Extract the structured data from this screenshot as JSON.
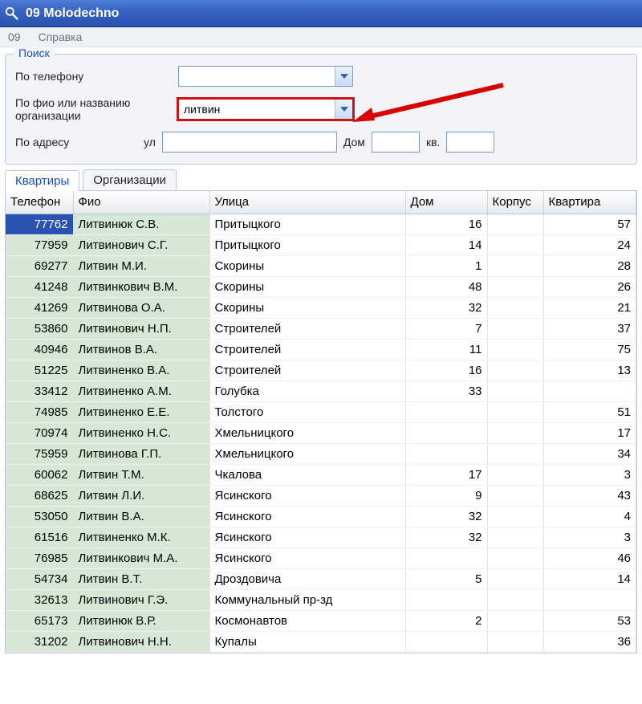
{
  "title": "09 Molodechno",
  "menu": {
    "item1": "09",
    "item2": "Справка"
  },
  "search": {
    "legend": "Поиск",
    "by_phone_label": "По телефону",
    "by_phone_value": "",
    "by_name_label": "По фио или названию организации",
    "by_name_value": "литвин",
    "by_addr_label": "По адресу",
    "street_label": "ул",
    "street_value": "",
    "house_label": "Дом",
    "house_value": "",
    "flat_label": "кв.",
    "flat_value": ""
  },
  "tabs": {
    "tab1": "Квартиры",
    "tab2": "Организации"
  },
  "columns": {
    "tel": "Телефон",
    "fio": "Фио",
    "street": "Улица",
    "house": "Дом",
    "korpus": "Корпус",
    "flat": "Квартира"
  },
  "rows": [
    {
      "tel": "77762",
      "fio": "Литвинюк С.В.",
      "street": "Притыцкого",
      "house": "16",
      "korpus": "",
      "flat": "57",
      "selected": true
    },
    {
      "tel": "77959",
      "fio": "Литвинович С.Г.",
      "street": "Притыцкого",
      "house": "14",
      "korpus": "",
      "flat": "24"
    },
    {
      "tel": "69277",
      "fio": "Литвин М.И.",
      "street": "Скорины",
      "house": "1",
      "korpus": "",
      "flat": "28"
    },
    {
      "tel": "41248",
      "fio": "Литвинкович В.М.",
      "street": "Скорины",
      "house": "48",
      "korpus": "",
      "flat": "26"
    },
    {
      "tel": "41269",
      "fio": "Литвинова О.А.",
      "street": "Скорины",
      "house": "32",
      "korpus": "",
      "flat": "21"
    },
    {
      "tel": "53860",
      "fio": "Литвинович Н.П.",
      "street": "Строителей",
      "house": "7",
      "korpus": "",
      "flat": "37"
    },
    {
      "tel": "40946",
      "fio": "Литвинов В.А.",
      "street": "Строителей",
      "house": "11",
      "korpus": "",
      "flat": "75"
    },
    {
      "tel": "51225",
      "fio": "Литвиненко В.А.",
      "street": "Строителей",
      "house": "16",
      "korpus": "",
      "flat": "13"
    },
    {
      "tel": "33412",
      "fio": "Литвиненко А.М.",
      "street": "Голубка",
      "house": "33",
      "korpus": "",
      "flat": ""
    },
    {
      "tel": "74985",
      "fio": "Литвиненко Е.Е.",
      "street": "Толстого",
      "house": "",
      "korpus": "",
      "flat": "51"
    },
    {
      "tel": "70974",
      "fio": "Литвиненко Н.С.",
      "street": "Хмельницкого",
      "house": "",
      "korpus": "",
      "flat": "17"
    },
    {
      "tel": "75959",
      "fio": "Литвинова Г.П.",
      "street": "Хмельницкого",
      "house": "",
      "korpus": "",
      "flat": "34"
    },
    {
      "tel": "60062",
      "fio": "Литвин Т.М.",
      "street": "Чкалова",
      "house": "17",
      "korpus": "",
      "flat": "3"
    },
    {
      "tel": "68625",
      "fio": "Литвин Л.И.",
      "street": "Ясинского",
      "house": "9",
      "korpus": "",
      "flat": "43"
    },
    {
      "tel": "53050",
      "fio": "Литвин В.А.",
      "street": "Ясинского",
      "house": "32",
      "korpus": "",
      "flat": "4"
    },
    {
      "tel": "61516",
      "fio": "Литвиненко М.К.",
      "street": "Ясинского",
      "house": "32",
      "korpus": "",
      "flat": "3"
    },
    {
      "tel": "76985",
      "fio": "Литвинкович М.А.",
      "street": "Ясинского",
      "house": "",
      "korpus": "",
      "flat": "46"
    },
    {
      "tel": "54734",
      "fio": "Литвин В.Т.",
      "street": "Дроздовича",
      "house": "5",
      "korpus": "",
      "flat": "14"
    },
    {
      "tel": "32613",
      "fio": "Литвинович Г.Э.",
      "street": "Коммунальный пр-зд",
      "house": "",
      "korpus": "",
      "flat": ""
    },
    {
      "tel": "65173",
      "fio": "Литвинюк В.Р.",
      "street": "Космонавтов",
      "house": "2",
      "korpus": "",
      "flat": "53"
    },
    {
      "tel": "31202",
      "fio": "Литвинович Н.Н.",
      "street": "Купалы",
      "house": "",
      "korpus": "",
      "flat": "36"
    }
  ]
}
